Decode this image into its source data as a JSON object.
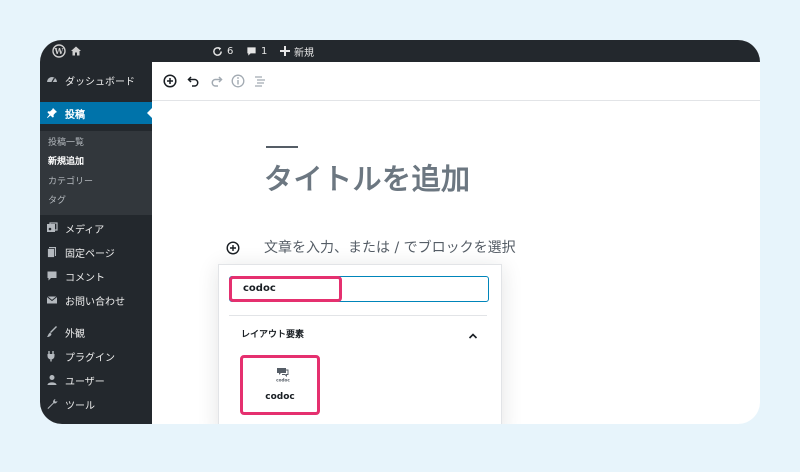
{
  "adminbar": {
    "updates_count": "6",
    "comments_count": "1",
    "new_label": "新規"
  },
  "sidebar": {
    "items": [
      {
        "label": "ダッシュボード",
        "icon": "dashboard-icon"
      },
      {
        "label": "投稿",
        "icon": "pin-icon",
        "active": true
      },
      {
        "label": "メディア",
        "icon": "media-icon"
      },
      {
        "label": "固定ページ",
        "icon": "pages-icon"
      },
      {
        "label": "コメント",
        "icon": "comment-icon"
      },
      {
        "label": "お問い合わせ",
        "icon": "mail-icon"
      },
      {
        "label": "外観",
        "icon": "brush-icon"
      },
      {
        "label": "プラグイン",
        "icon": "plugin-icon"
      },
      {
        "label": "ユーザー",
        "icon": "user-icon"
      },
      {
        "label": "ツール",
        "icon": "wrench-icon"
      }
    ],
    "submenu": [
      {
        "label": "投稿一覧"
      },
      {
        "label": "新規追加",
        "current": true
      },
      {
        "label": "カテゴリー"
      },
      {
        "label": "タグ"
      }
    ]
  },
  "toolbar": {
    "icons": [
      "add-block-icon",
      "undo-icon",
      "redo-icon",
      "info-icon",
      "outline-icon"
    ]
  },
  "editor": {
    "title_placeholder": "タイトルを追加",
    "block_placeholder": "文章を入力、または / でブロックを選択"
  },
  "inserter": {
    "search_value": "codoc",
    "panel_title": "レイアウト要素",
    "block": {
      "label": "codoc",
      "icon_text": "codoc"
    }
  },
  "colors": {
    "admin_bg": "#23282d",
    "active_menu": "#0073aa",
    "highlight": "#e5306f",
    "focus": "#0085ba",
    "page_bg": "#e7f4fb"
  }
}
